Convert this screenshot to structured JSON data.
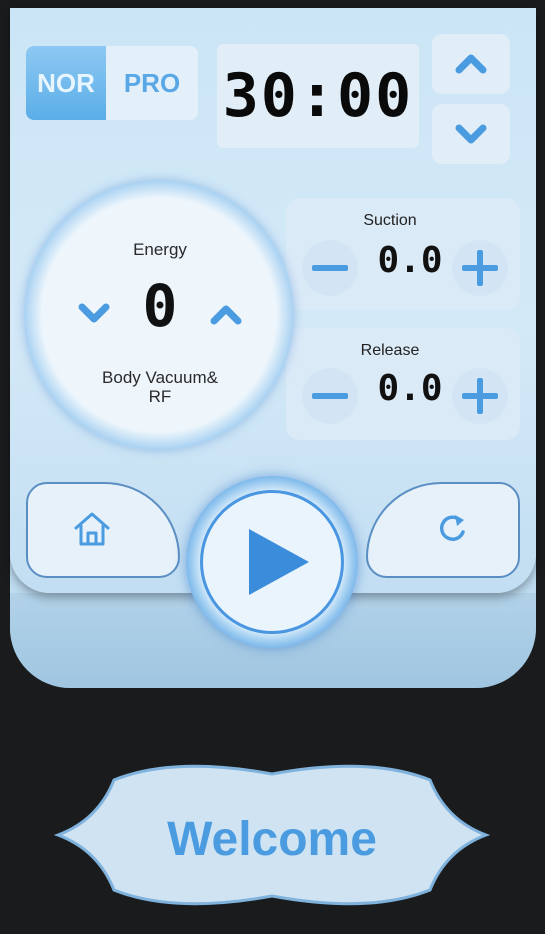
{
  "mode": {
    "options": [
      "NOR",
      "PRO"
    ],
    "selected": "NOR"
  },
  "timer": {
    "display": "30:00"
  },
  "energy": {
    "label": "Energy",
    "value": "0",
    "program": "Body Vacuum&\nRF"
  },
  "suction": {
    "label": "Suction",
    "value": "0.0"
  },
  "release": {
    "label": "Release",
    "value": "0.0"
  },
  "footer": {
    "welcome": "Welcome"
  },
  "icons": {
    "timer_up": "chevron-up-icon",
    "timer_down": "chevron-down-icon",
    "home": "home-icon",
    "reset": "refresh-icon",
    "play": "play-icon",
    "minus": "minus-icon",
    "plus": "plus-icon"
  },
  "colors": {
    "accent": "#4a9be0",
    "panel": "#cbe5f6",
    "active_mode": "#5aaee8",
    "text": "#111111"
  }
}
